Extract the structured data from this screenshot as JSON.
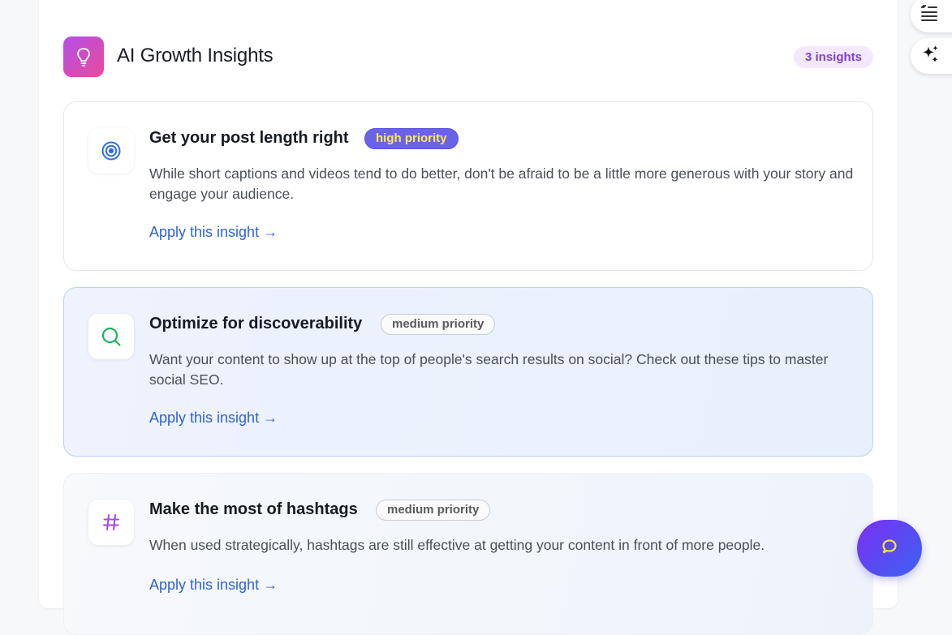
{
  "header": {
    "title": "AI Growth Insights",
    "icon": "lightbulb-icon",
    "count_badge": "3 insights"
  },
  "insights": [
    {
      "icon": "target-icon",
      "title": "Get your post length right",
      "priority": "high priority",
      "description": "While short captions and videos tend to do better, don't be afraid to be a little more generous with your story and engage your audience.",
      "action": "Apply this insight →"
    },
    {
      "icon": "search-icon",
      "title": "Optimize for discoverability",
      "priority": "medium priority",
      "description": "Want your content to show up at the top of people's search results on social? Check out these tips to master social SEO.",
      "action": "Apply this insight →"
    },
    {
      "icon": "hashtag-icon",
      "title": "Make the most of hashtags",
      "priority": "medium priority",
      "description": "When used strategically, hashtags are still effective at getting your content in front of more people.",
      "action": "Apply this insight →"
    }
  ],
  "side_tools": [
    "quote-list-icon",
    "sparkles-icon"
  ],
  "chat_button": "chat-bubble-icon",
  "colors": {
    "accent_gradient_start": "#7b2ff2",
    "accent_gradient_end": "#3b63f2",
    "link": "#2d62d8",
    "high_priority_bg": "#6b63e6",
    "high_priority_text": "#ffe957"
  }
}
